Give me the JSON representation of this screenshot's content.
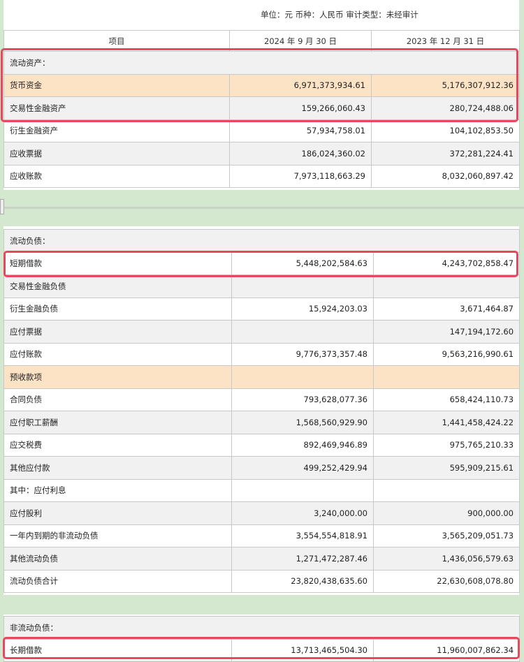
{
  "header": {
    "unit_text": "单位：元  币种：人民币  审计类型：未经审计",
    "col_item": "项目",
    "col_2024": "2024 年 9 月 30 日",
    "col_2023": "2023 年 12 月 31 日"
  },
  "current_assets": {
    "section_label": "流动资产：",
    "rows": [
      {
        "label": "货币资金",
        "v2024": "6,971,373,934.61",
        "v2023": "5,176,307,912.36"
      },
      {
        "label": "交易性金融资产",
        "v2024": "159,266,060.43",
        "v2023": "280,724,488.06"
      },
      {
        "label": "衍生金融资产",
        "v2024": "57,934,758.01",
        "v2023": "104,102,853.50"
      },
      {
        "label": "应收票据",
        "v2024": "186,024,360.02",
        "v2023": "372,281,224.41"
      },
      {
        "label": "应收账款",
        "v2024": "7,973,118,663.29",
        "v2023": "8,032,060,897.42"
      }
    ]
  },
  "current_liabilities": {
    "section_label": "流动负债：",
    "rows": [
      {
        "label": "短期借款",
        "v2024": "5,448,202,584.63",
        "v2023": "4,243,702,858.47"
      },
      {
        "label": "交易性金融负债",
        "v2024": "",
        "v2023": ""
      },
      {
        "label": "衍生金融负债",
        "v2024": "15,924,203.03",
        "v2023": "3,671,464.87"
      },
      {
        "label": "应付票据",
        "v2024": "",
        "v2023": "147,194,172.60"
      },
      {
        "label": "应付账款",
        "v2024": "9,776,373,357.48",
        "v2023": "9,563,216,990.61"
      },
      {
        "label": "预收款项",
        "v2024": "",
        "v2023": ""
      },
      {
        "label": "合同负债",
        "v2024": "793,628,077.36",
        "v2023": "658,424,110.73"
      },
      {
        "label": "应付职工薪酬",
        "v2024": "1,568,560,929.90",
        "v2023": "1,441,458,424.22"
      },
      {
        "label": "应交税费",
        "v2024": "892,469,946.89",
        "v2023": "975,765,210.33"
      },
      {
        "label": "其他应付款",
        "v2024": "499,252,429.94",
        "v2023": "595,909,215.61"
      },
      {
        "label": "其中：应付利息",
        "v2024": "",
        "v2023": ""
      },
      {
        "label": "应付股利",
        "v2024": "3,240,000.00",
        "v2023": "900,000.00"
      },
      {
        "label": "一年内到期的非流动负债",
        "v2024": "3,554,554,818.91",
        "v2023": "3,565,209,051.73"
      },
      {
        "label": "其他流动负债",
        "v2024": "1,271,472,287.46",
        "v2023": "1,436,056,579.63"
      },
      {
        "label": "流动负债合计",
        "v2024": "23,820,438,635.60",
        "v2023": "22,630,608,078.80"
      }
    ]
  },
  "noncurrent_liabilities": {
    "section_label": "非流动负债：",
    "rows": [
      {
        "label": "长期借款",
        "v2024": "13,713,465,504.30",
        "v2023": "11,960,007,862.34"
      }
    ]
  },
  "icons": {
    "copy": "copy-icon"
  },
  "colors": {
    "highlight": "#e8485e",
    "peach": "#fce3c6",
    "gray_row": "#f1f1f1",
    "background": "#d3e8cf"
  }
}
